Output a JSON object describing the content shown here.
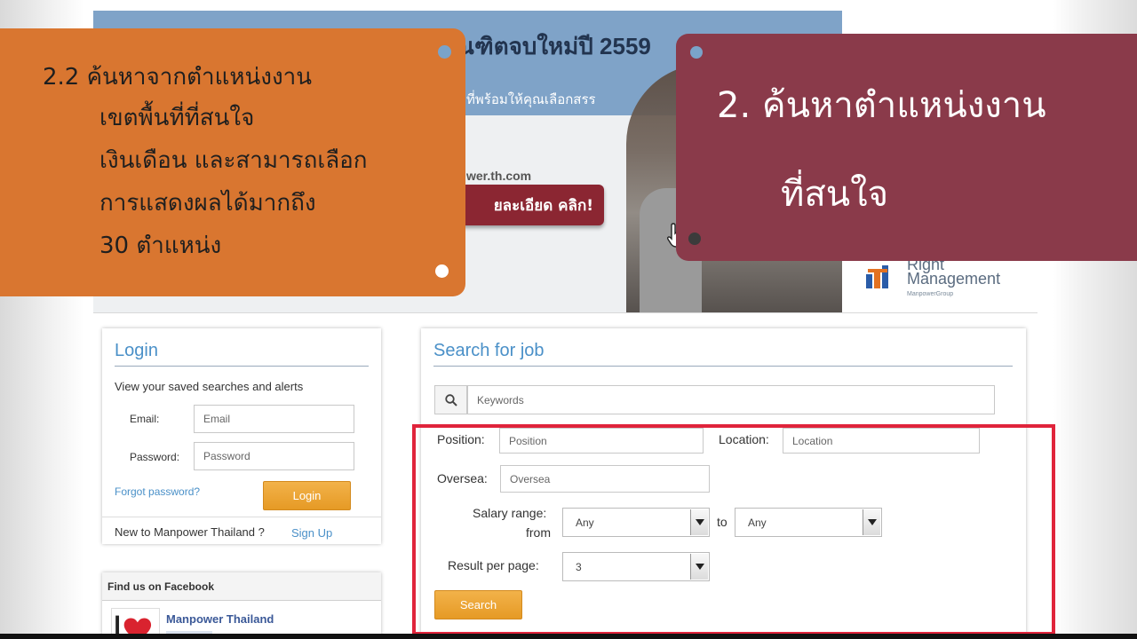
{
  "banner": {
    "headline": "ณฑิตจบใหม่ปี 2559",
    "subline": "ที่พร้อมให้คุณเลือกสรร",
    "url": "wer.th.com",
    "cta": "ยละเอียด คลิก!"
  },
  "partner_logo": {
    "name_line1": "Right",
    "name_line2": "Management",
    "sub": "ManpowerGroup"
  },
  "callout_left": {
    "lines": [
      "2.2  ค้นหาจากตำแหน่งงาน",
      "เขตพื้นที่ที่สนใจ",
      "เงินเดือน และสามารถเลือก",
      "การแสดงผลได้มากถึง",
      "30 ตำแหน่ง"
    ],
    "color": "#d97630"
  },
  "callout_right": {
    "line1": "2. ค้นหาตำแหน่งงาน",
    "line2": "ที่สนใจ",
    "color": "#8a3a4a"
  },
  "login": {
    "title": "Login",
    "intro": "View your saved searches and alerts",
    "email_label": "Email:",
    "email_placeholder": "Email",
    "password_label": "Password:",
    "password_placeholder": "Password",
    "forgot": "Forgot password?",
    "button": "Login",
    "new_user": "New to Manpower Thailand ?",
    "signup": "Sign Up"
  },
  "facebook": {
    "title": "Find us on Facebook",
    "page_name": "Manpower Thailand"
  },
  "search": {
    "title": "Search for job",
    "keywords_placeholder": "Keywords",
    "position_label": "Position:",
    "position_placeholder": "Position",
    "location_label": "Location:",
    "location_placeholder": "Location",
    "oversea_label": "Oversea:",
    "oversea_placeholder": "Oversea",
    "salary_label_line1": "Salary range:",
    "salary_label_line2": "from",
    "salary_from": "Any",
    "to_label": "to",
    "salary_to": "Any",
    "result_label": "Result per page:",
    "result_value": "3",
    "button": "Search"
  },
  "colors": {
    "accent_blue": "#4a90c8",
    "button_orange": "#f2b24a",
    "highlight_red": "#e0243b"
  }
}
